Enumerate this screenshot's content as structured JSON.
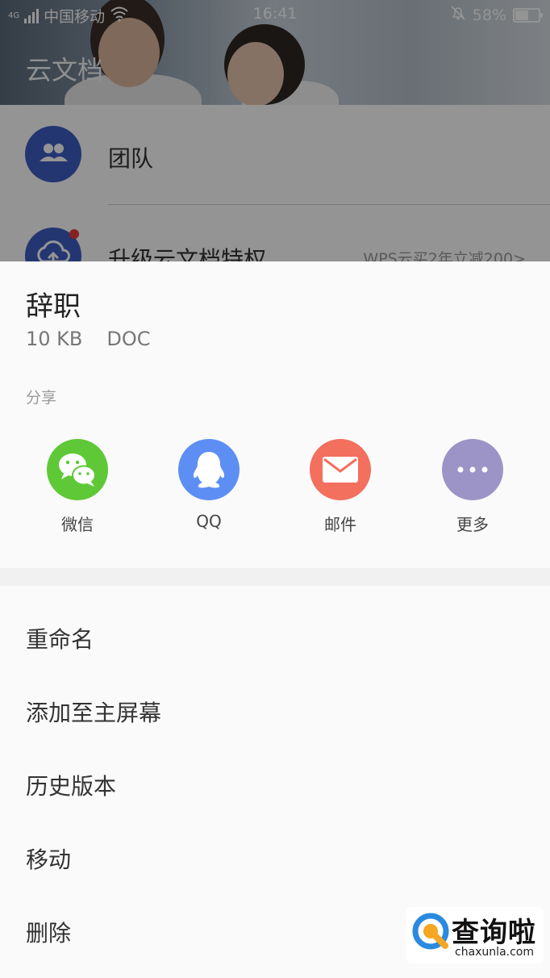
{
  "status_bar": {
    "network": "4G",
    "carrier": "中国移动",
    "time": "16:41",
    "battery_text": "58%",
    "battery_level": 0.58,
    "icons": [
      "signal-icon",
      "wifi-icon",
      "bell-off-icon",
      "battery-icon"
    ]
  },
  "background_app": {
    "title": "云文档",
    "rows": [
      {
        "label": "团队",
        "icon": "team-icon"
      },
      {
        "label": "升级云文档特权",
        "icon": "cloud-upload-icon",
        "promo": "WPS云买2年立减200>"
      }
    ]
  },
  "sheet": {
    "file_name": "辞职",
    "file_size": "10 KB",
    "file_type": "DOC",
    "share_title": "分享",
    "share_targets": [
      {
        "label": "微信",
        "icon": "wechat-icon",
        "color": "#5fc836"
      },
      {
        "label": "QQ",
        "icon": "qq-icon",
        "color": "#5d8ef4"
      },
      {
        "label": "邮件",
        "icon": "mail-icon",
        "color": "#f36f5e"
      },
      {
        "label": "更多",
        "icon": "more-icon",
        "color": "#9c94c7"
      }
    ],
    "menu": [
      "重命名",
      "添加至主屏幕",
      "历史版本",
      "移动",
      "删除"
    ]
  },
  "watermark": {
    "title": "查询啦",
    "subtitle": "chaxunla.com"
  }
}
